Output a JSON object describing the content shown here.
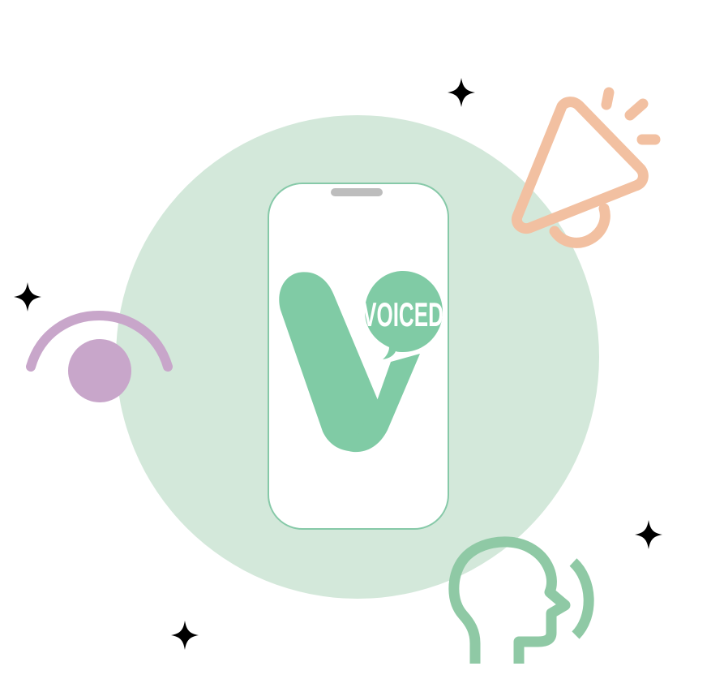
{
  "logo": {
    "text": "VOICED"
  },
  "colors": {
    "background": "#ffffff",
    "circle": "#d3e8da",
    "green": "#80cba5",
    "green_dark": "#8fc9a5",
    "phone_outline": "#86c9a8",
    "notch": "#bdbdbd",
    "megaphone": "#f2c0a1",
    "eye": "#c8a6ca",
    "star": "#000000"
  },
  "icons": {
    "sparkles": [
      "sparkle-icon",
      "sparkle-icon",
      "sparkle-icon",
      "sparkle-icon"
    ],
    "megaphone": "megaphone-icon",
    "eye": "eye-icon",
    "speaking_head": "speaking-head-icon",
    "phone": "phone-icon"
  }
}
